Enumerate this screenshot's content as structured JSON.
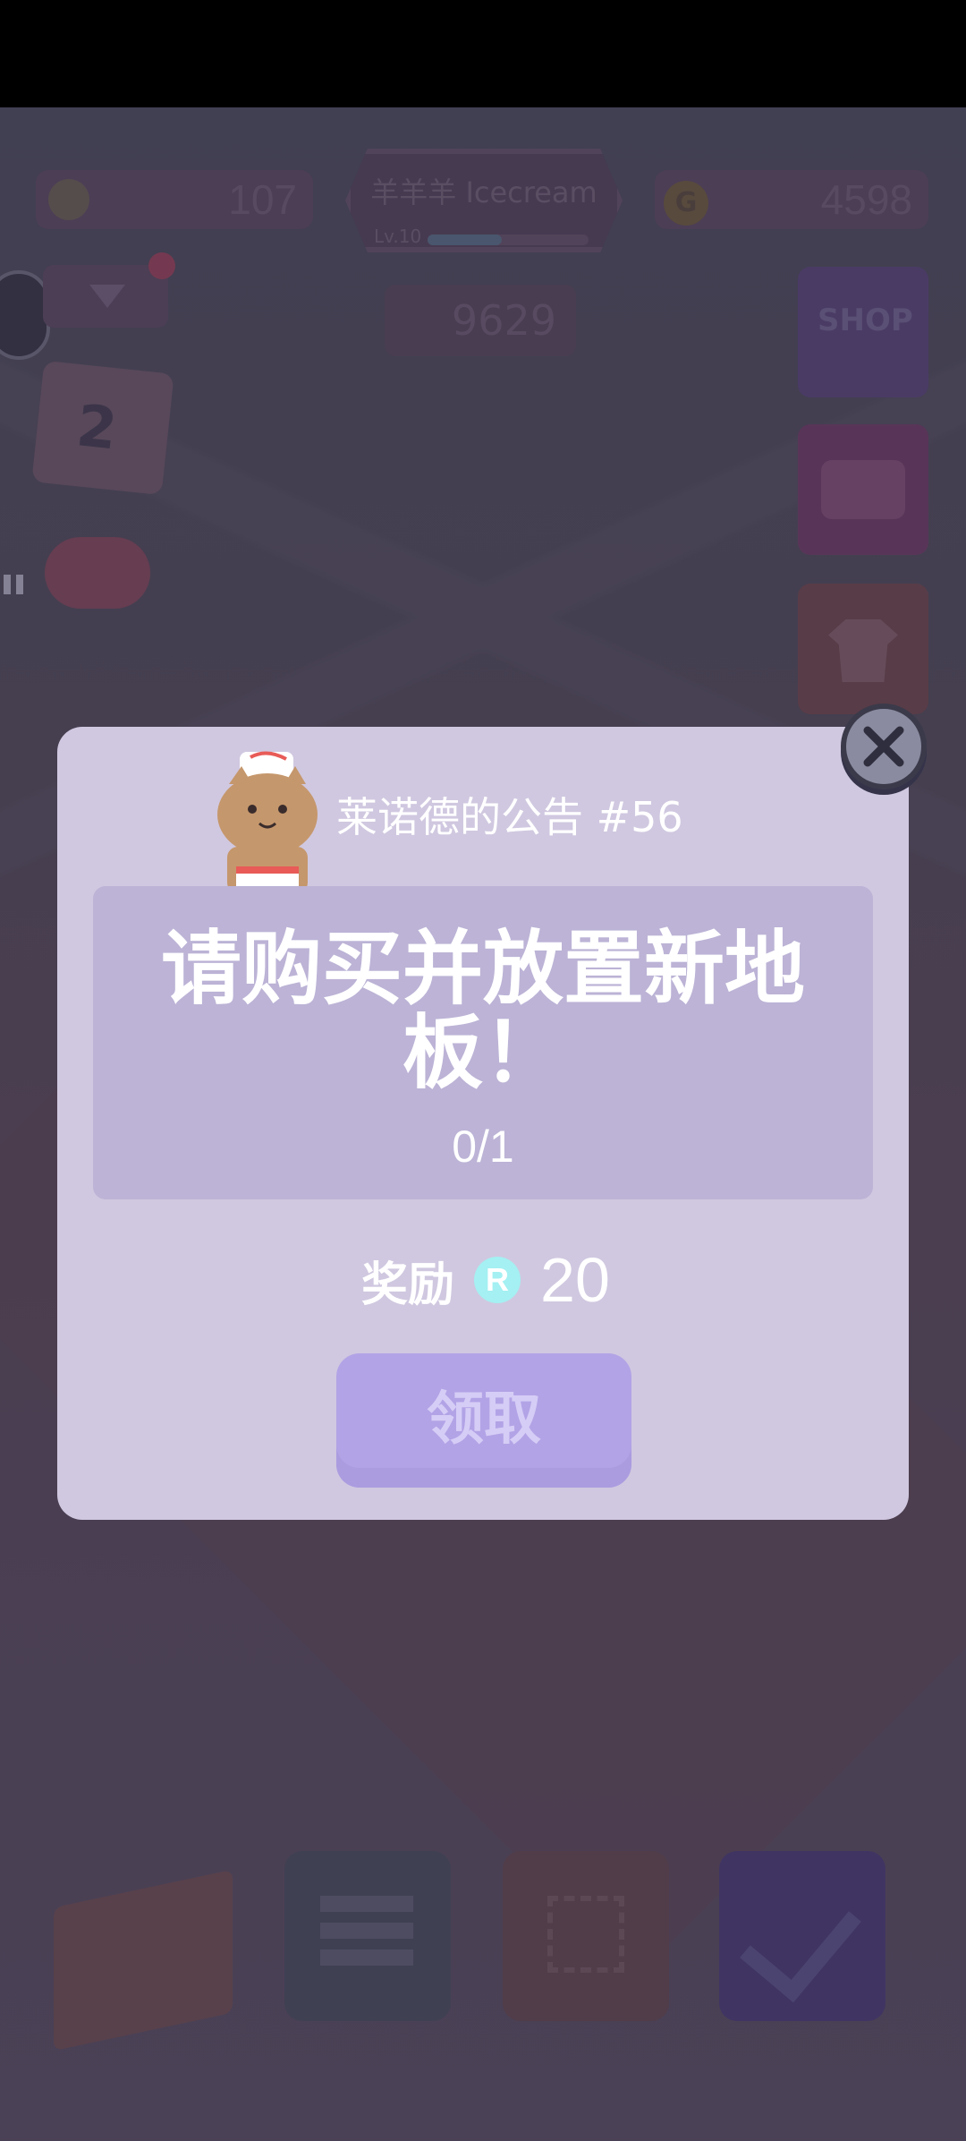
{
  "hud": {
    "left_count": "107",
    "player_name": "羊羊羊 Icecream",
    "level_text": "Lv.10",
    "level_progress": 0.46,
    "gold": "4598",
    "chat_count": "9629",
    "shop_label": "SHOP",
    "calendar_day": "2"
  },
  "dialog": {
    "title": "莱诺德的公告 #56",
    "message": "请购买并放置新地板！",
    "progress": "0/1",
    "reward_label": "奖励",
    "reward_icon_letter": "R",
    "reward_amount": "20",
    "claim_label": "领取"
  },
  "colors": {
    "dialog_bg": "#d0c8e0",
    "message_bg": "#bcb3d6",
    "claim_button": "#b2a3e6",
    "reward_icon": "#a4f0f2",
    "close_button": "#8a8ba0"
  },
  "icons": [
    "pause-icon",
    "calendar-icon",
    "gamepad-icon",
    "cart-icon",
    "chest-icon",
    "shirt-icon",
    "layers-icon",
    "expand-icon",
    "check-icon",
    "close-icon",
    "cat-mascot-icon",
    "reward-currency-icon"
  ]
}
